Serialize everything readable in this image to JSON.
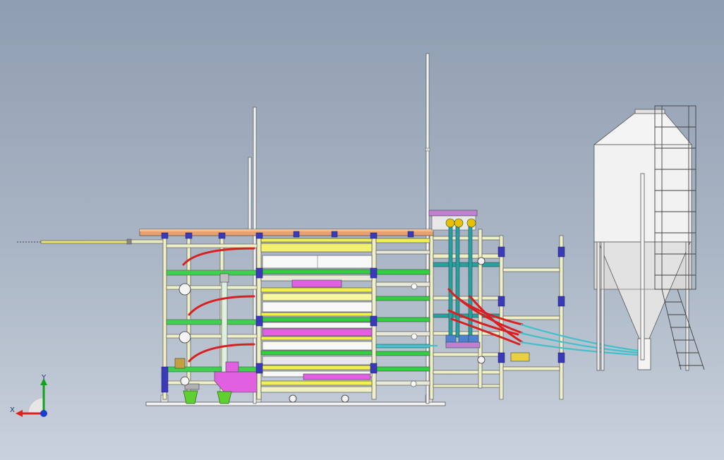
{
  "viewport": {
    "background_top": "#8f9db1",
    "background_bottom": "#c9d1dc"
  },
  "triad": {
    "x_label": "X",
    "y_label": "Y",
    "x_color": "#e0201c",
    "y_color": "#14a11c",
    "z_color": "#1a3ccf"
  },
  "colors": {
    "frame": "#f0f0c8",
    "blue_joint": "#3a3ab8",
    "orange_rail": "#e8a070",
    "green": "#30d040",
    "yellow": "#f0f050",
    "magenta": "#e060e0",
    "red_hose": "#d82020",
    "cyan_hose": "#40c0c8",
    "teal": "#28a0a0",
    "silo": "#f2f2f2",
    "lime_bucket": "#60d030"
  }
}
